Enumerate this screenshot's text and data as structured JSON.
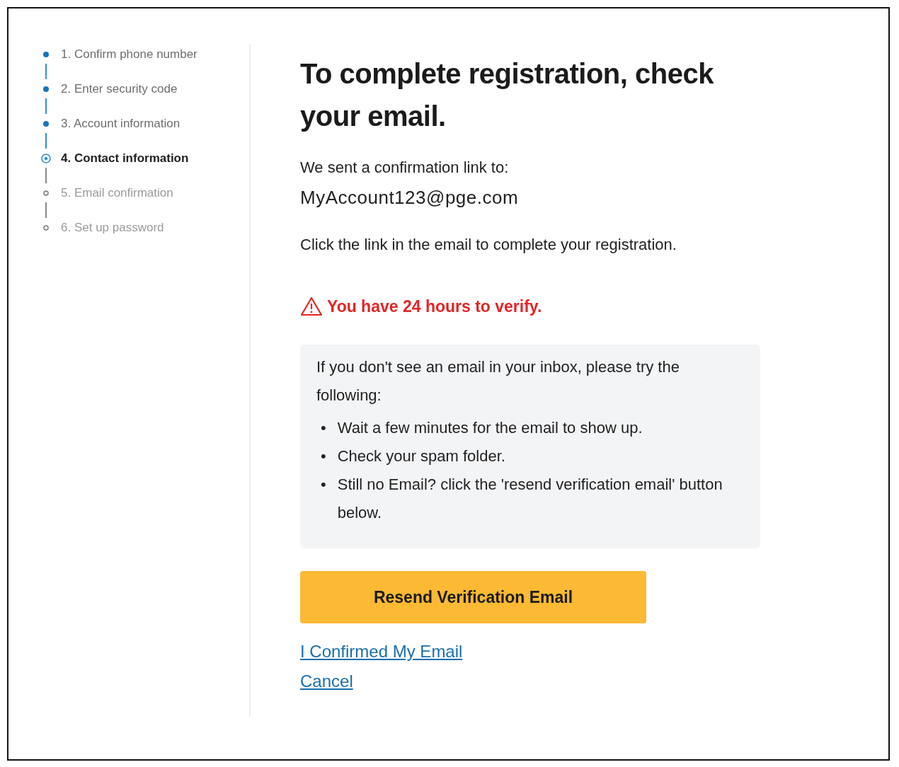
{
  "steps": [
    {
      "label": "1. Confirm phone number",
      "kind": "done"
    },
    {
      "label": "2. Enter security code",
      "kind": "done"
    },
    {
      "label": "3. Account information",
      "kind": "done"
    },
    {
      "label": "4. Contact information",
      "kind": "current"
    },
    {
      "label": "5. Email confirmation",
      "kind": "pending"
    },
    {
      "label": "6. Set up password",
      "kind": "pending"
    }
  ],
  "title": "To complete registration, check your email.",
  "sent_label": "We sent a confirmation link to:",
  "email": "MyAccount123@pge.com",
  "instruction": "Click the link in the email to complete your registration.",
  "warning": "You have 24 hours to verify.",
  "help_box": {
    "intro": "If you don't see an email in your inbox, please try the following:",
    "tips": [
      {
        "marker": "•",
        "text": "Wait a few minutes for the email to show up."
      },
      {
        "marker": "•",
        "text": "Check your spam folder."
      },
      {
        "marker": "•",
        "text": "Still no Email? click the 'resend verification email' button below."
      }
    ]
  },
  "resend_button": "Resend Verification Email",
  "links": [
    "I Confirmed My Email",
    "Cancel"
  ]
}
